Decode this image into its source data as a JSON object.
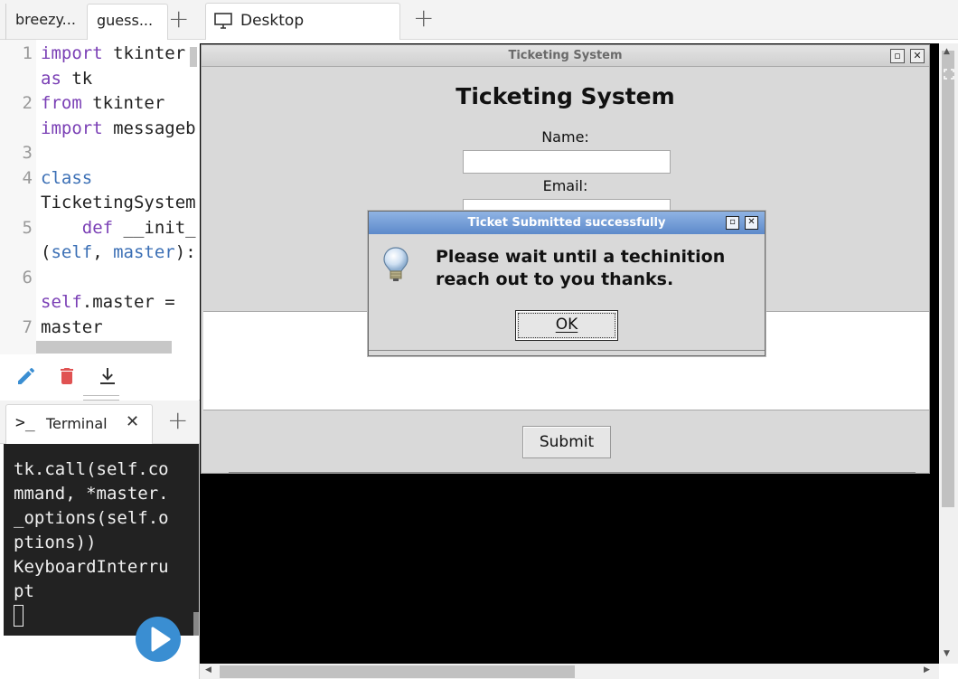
{
  "left_tabs": [
    {
      "label": "breezy..."
    },
    {
      "label": "guess..."
    }
  ],
  "editor": {
    "line_numbers": [
      "1",
      "2",
      "3",
      "4",
      "5",
      "6",
      "7"
    ],
    "lines": [
      {
        "segments": [
          [
            "kw",
            "import"
          ],
          [
            "",
            " tkinter"
          ]
        ]
      },
      {
        "segments": [
          [
            "kw",
            "as"
          ],
          [
            "",
            " tk"
          ]
        ]
      },
      {
        "segments": [
          [
            "kw",
            "from"
          ],
          [
            "",
            " tkinter"
          ]
        ]
      },
      {
        "segments": [
          [
            "kw",
            "import"
          ],
          [
            "",
            " messageb"
          ]
        ]
      },
      {
        "segments": [
          [
            "",
            ""
          ]
        ]
      },
      {
        "segments": [
          [
            "blue",
            "class"
          ]
        ]
      },
      {
        "segments": [
          [
            "",
            "TicketingSystem"
          ]
        ]
      },
      {
        "segments": [
          [
            "",
            "    "
          ],
          [
            "kw",
            "def"
          ],
          [
            "",
            " __init_"
          ]
        ]
      },
      {
        "segments": [
          [
            "",
            "("
          ],
          [
            "blue",
            "self"
          ],
          [
            "",
            ", "
          ],
          [
            "blue",
            "master"
          ],
          [
            "",
            "):"
          ]
        ]
      },
      {
        "segments": [
          [
            "",
            ""
          ]
        ]
      },
      {
        "segments": [
          [
            "kw",
            "self"
          ],
          [
            "",
            ".master ="
          ]
        ]
      },
      {
        "segments": [
          [
            "",
            "master"
          ]
        ]
      }
    ]
  },
  "terminal_tab": {
    "label": "Terminal"
  },
  "terminal": {
    "output": "tk.call(self.co\nmmand, *master.\n_options(self.o\nptions))\nKeyboardInterru\npt"
  },
  "desktop_tab": {
    "label": "Desktop"
  },
  "tk_window": {
    "title": "Ticketing System",
    "heading": "Ticketing System",
    "name_label": "Name:",
    "email_label": "Email:",
    "submit_label": "Submit"
  },
  "dialog": {
    "title": "Ticket Submitted successfully",
    "message": "Please wait until a techinition reach out to you thanks.",
    "ok_label": "OK"
  },
  "colors": {
    "run_button": "#3a8ed2",
    "dialog_titlebar": "#5d8acb",
    "delete_icon": "#e05252",
    "edit_icon": "#3a8ed2"
  }
}
